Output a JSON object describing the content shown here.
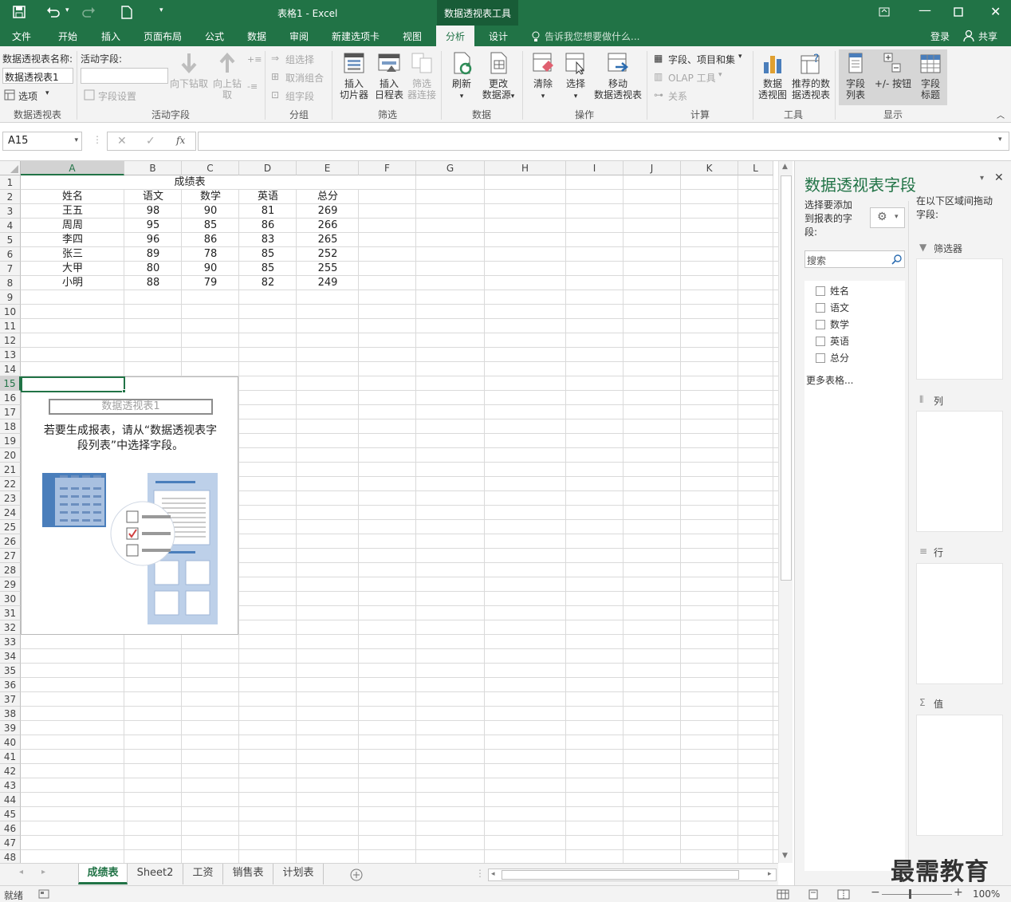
{
  "window": {
    "title": "表格1 - Excel",
    "context_tool": "数据透视表工具"
  },
  "tabs": [
    "文件",
    "开始",
    "插入",
    "页面布局",
    "公式",
    "数据",
    "审阅",
    "新建选项卡",
    "视图",
    "分析",
    "设计"
  ],
  "active_tab": "分析",
  "tellme": "告诉我您想要做什么...",
  "account": {
    "login": "登录",
    "share": "共享"
  },
  "ribbon": {
    "pt_name_label": "数据透视表名称:",
    "pt_name_value": "数据透视表1",
    "options": "选项",
    "active_field_label": "活动字段:",
    "field_settings": "字段设置",
    "drill_down": "向下钻取",
    "drill_up_1": "向上钻",
    "drill_up_2": "取",
    "group_selection": "组选择",
    "ungroup": "取消组合",
    "group_field": "组字段",
    "insert_slicer_1": "插入",
    "insert_slicer_2": "切片器",
    "insert_timeline_1": "插入",
    "insert_timeline_2": "日程表",
    "filter_conn_1": "筛选",
    "filter_conn_2": "器连接",
    "refresh": "刷新",
    "change_source_1": "更改",
    "change_source_2": "数据源",
    "clear": "清除",
    "select": "选择",
    "move_1": "移动",
    "move_2": "数据透视表",
    "fields_items": "字段、项目和集",
    "olap": "OLAP 工具",
    "relations": "关系",
    "pivotchart_1": "数据",
    "pivotchart_2": "透视图",
    "recommended_1": "推荐的数",
    "recommended_2": "据透视表",
    "field_list_1": "字段",
    "field_list_2": "列表",
    "buttons": "+/- 按钮",
    "field_headers_1": "字段",
    "field_headers_2": "标题",
    "groups": {
      "pivottable": "数据透视表",
      "active_field": "活动字段",
      "group": "分组",
      "filter": "筛选",
      "data": "数据",
      "actions": "操作",
      "calc": "计算",
      "tools": "工具",
      "show": "显示"
    }
  },
  "formula_bar": {
    "name_box": "A15",
    "fx": "fx",
    "value": ""
  },
  "columns": [
    "A",
    "B",
    "C",
    "D",
    "E",
    "F",
    "G",
    "H",
    "I",
    "J",
    "K",
    "L"
  ],
  "rows": [
    "1",
    "2",
    "3",
    "4",
    "5",
    "6",
    "7",
    "8",
    "9",
    "10",
    "11",
    "12",
    "13",
    "14",
    "15",
    "16",
    "17",
    "18",
    "19",
    "20",
    "21",
    "22",
    "23",
    "24",
    "25",
    "26",
    "27",
    "28",
    "29",
    "30",
    "31",
    "32",
    "33",
    "34",
    "35",
    "36",
    "37",
    "38",
    "39",
    "40",
    "41",
    "42",
    "43",
    "44",
    "45",
    "46",
    "47",
    "48"
  ],
  "table": {
    "title": "成绩表",
    "headers": [
      "姓名",
      "语文",
      "数学",
      "英语",
      "总分"
    ],
    "rows": [
      [
        "王五",
        "98",
        "90",
        "81",
        "269"
      ],
      [
        "周周",
        "95",
        "85",
        "86",
        "266"
      ],
      [
        "李四",
        "96",
        "86",
        "83",
        "265"
      ],
      [
        "张三",
        "89",
        "78",
        "85",
        "252"
      ],
      [
        "大甲",
        "80",
        "90",
        "85",
        "255"
      ],
      [
        "小明",
        "88",
        "79",
        "82",
        "249"
      ]
    ]
  },
  "pivot_placeholder": {
    "name": "数据透视表1",
    "hint_1": "若要生成报表，请从“数据透视表字",
    "hint_2": "段列表”中选择字段。"
  },
  "sheet_tabs": [
    "成绩表",
    "Sheet2",
    "工资",
    "销售表",
    "计划表"
  ],
  "active_sheet": "成绩表",
  "status": {
    "ready": "就绪",
    "zoom": "100%"
  },
  "field_panel": {
    "title": "数据透视表字段",
    "choose_1": "选择要添加",
    "choose_2": "到报表的字",
    "choose_3": "段:",
    "drag_1": "在以下区域间拖动",
    "drag_2": "字段:",
    "search_placeholder": "搜索",
    "fields": [
      "姓名",
      "语文",
      "数学",
      "英语",
      "总分"
    ],
    "more_tables": "更多表格...",
    "areas": {
      "filter": "筛选器",
      "columns": "列",
      "rows": "行",
      "values": "值"
    }
  },
  "watermark": "最需教育",
  "colors": {
    "excel_green": "#217346",
    "accent": "#217346"
  }
}
